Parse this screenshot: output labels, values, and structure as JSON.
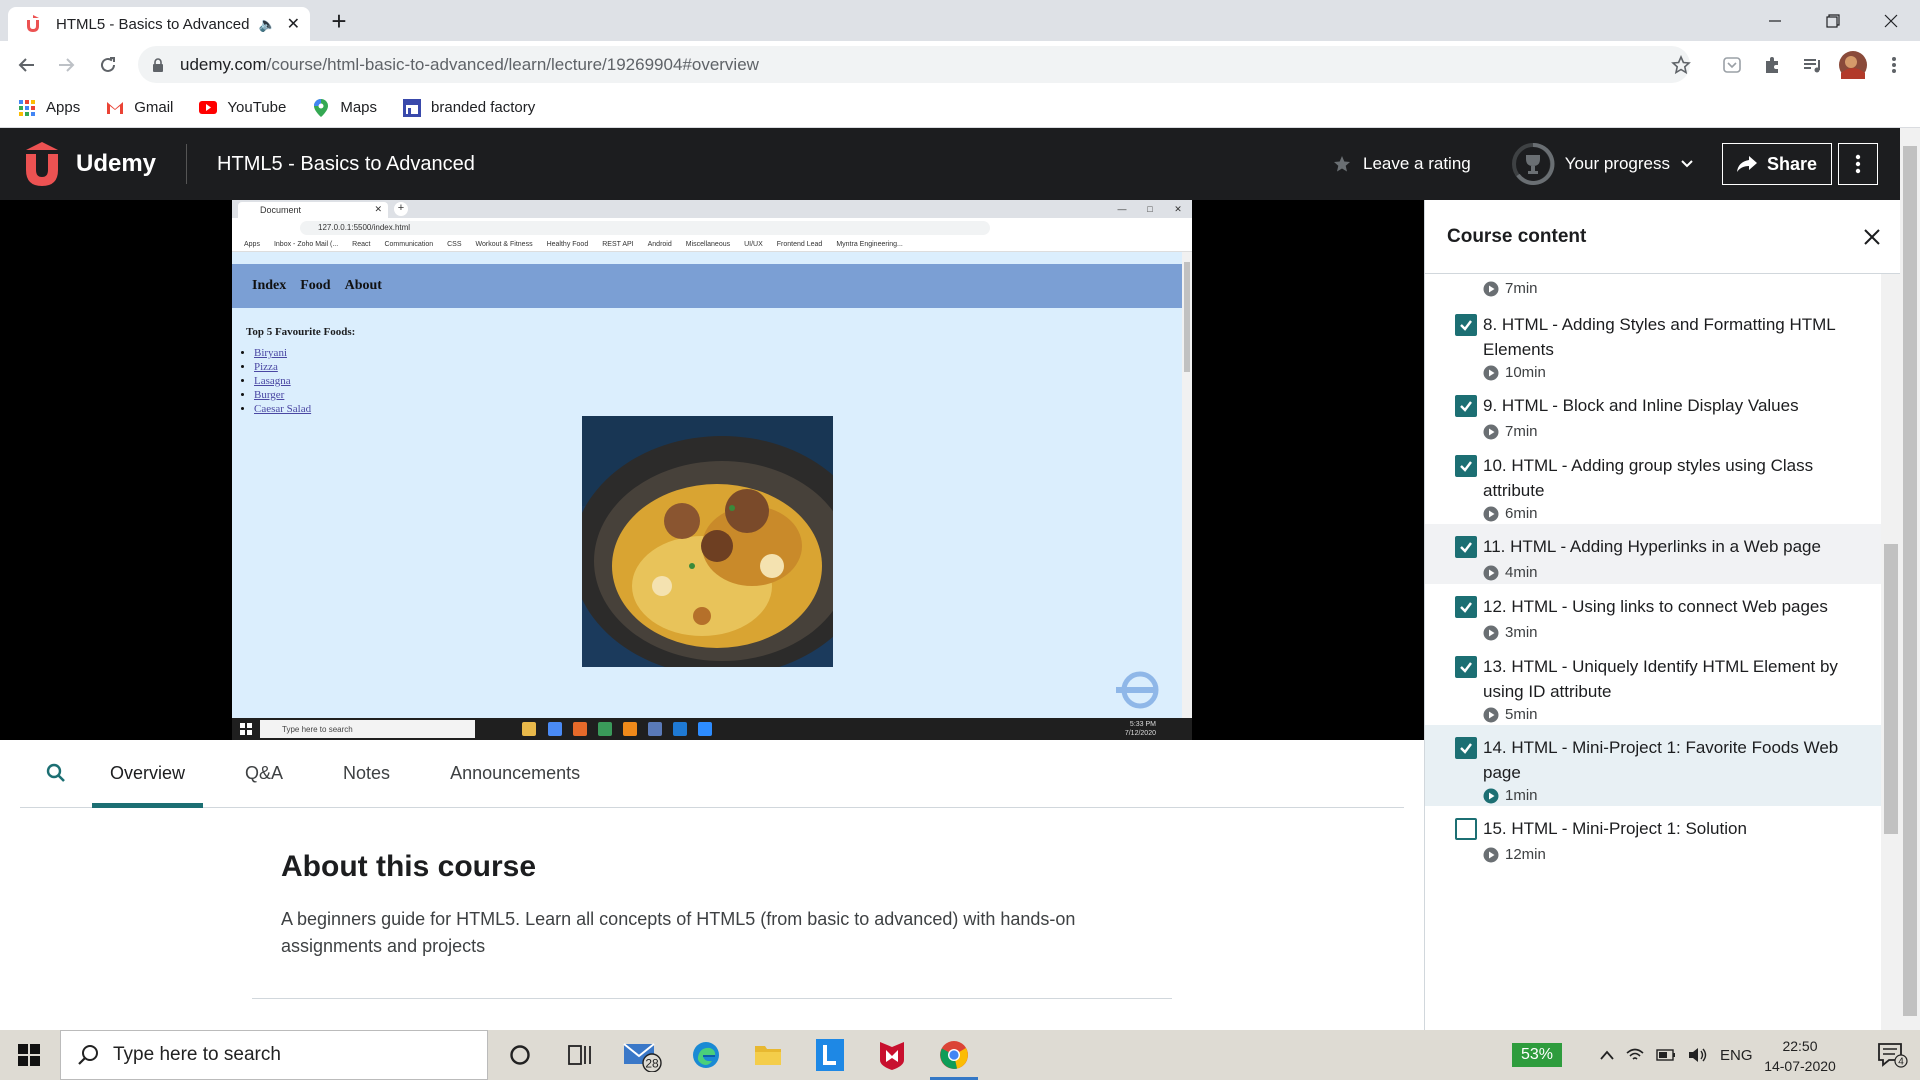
{
  "browser": {
    "tab_title": "HTML5 - Basics to Advanced",
    "url_host": "udemy.com",
    "url_path": "/course/html-basic-to-advanced/learn/lecture/19269904#overview",
    "bookmarks": [
      "Apps",
      "Gmail",
      "YouTube",
      "Maps",
      "branded factory"
    ]
  },
  "header": {
    "logo_text": "Udemy",
    "course_title": "HTML5 - Basics to Advanced",
    "rating_label": "Leave a rating",
    "progress_label": "Your progress",
    "share_label": "Share"
  },
  "video": {
    "inner_tab_title": "Document",
    "inner_url": "127.0.0.1:5500/index.html",
    "inner_bookmarks": [
      "Apps",
      "Inbox - Zoho Mail (...",
      "React",
      "Communication",
      "CSS",
      "Workout & Fitness",
      "Healthy Food",
      "REST API",
      "Android",
      "Miscellaneous",
      "UI/UX",
      "Frontend Lead",
      "Myntra Engineering..."
    ],
    "nav_links": [
      "Index",
      "Food",
      "About"
    ],
    "heading": "Top 5 Favourite Foods:",
    "foods": [
      "Biryani",
      "Pizza",
      "Lasagna",
      "Burger",
      "Caesar Salad"
    ],
    "taskbar_search": "Type here to search",
    "inner_time": "5:33 PM",
    "inner_date": "7/12/2020"
  },
  "content_tabs": [
    "Overview",
    "Q&A",
    "Notes",
    "Announcements"
  ],
  "about": {
    "heading": "About this course",
    "description": "A beginners guide for HTML5. Learn all concepts of HTML5 (from basic to advanced) with hands-on assignments and projects"
  },
  "sidebar": {
    "title": "Course content",
    "top_duration": "7min",
    "lectures": [
      {
        "title": "8. HTML - Adding Styles and Formatting HTML Elements",
        "duration": "10min",
        "done": true
      },
      {
        "title": "9. HTML - Block and Inline Display Values",
        "duration": "7min",
        "done": true
      },
      {
        "title": "10. HTML - Adding group styles using Class attribute",
        "duration": "6min",
        "done": true
      },
      {
        "title": "11. HTML - Adding Hyperlinks in a Web page",
        "duration": "4min",
        "done": true
      },
      {
        "title": "12. HTML - Using links to connect Web pages",
        "duration": "3min",
        "done": true
      },
      {
        "title": "13. HTML - Uniquely Identify HTML Element by using ID attribute",
        "duration": "5min",
        "done": true
      },
      {
        "title": "14. HTML - Mini-Project 1: Favorite Foods Web page",
        "duration": "1min",
        "done": true
      },
      {
        "title": "15. HTML - Mini-Project 1: Solution",
        "duration": "12min",
        "done": false
      }
    ]
  },
  "taskbar": {
    "search_placeholder": "Type here to search",
    "mail_badge": "28",
    "battery": "53%",
    "lang": "ENG",
    "time": "22:50",
    "date": "14-07-2020",
    "notifications": "4"
  },
  "colors": {
    "udemy_red": "#ec5252",
    "accent": "#1c6f73",
    "header_bg": "#1c1d1f"
  }
}
